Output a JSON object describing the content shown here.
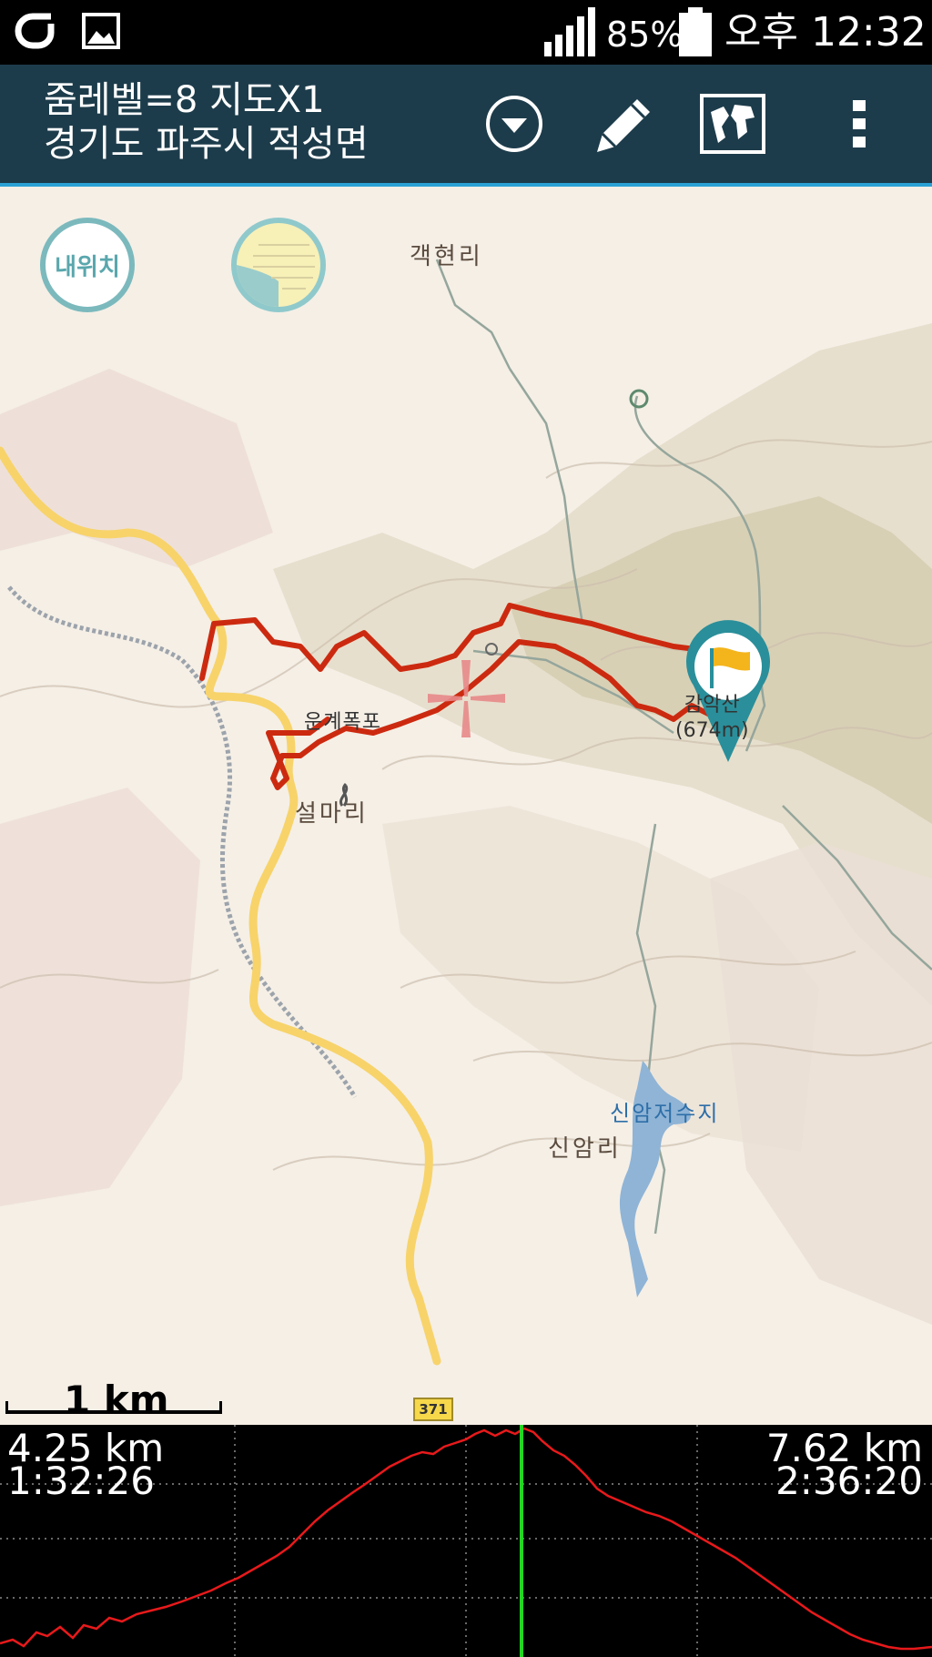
{
  "status_bar": {
    "battery_percent": "85%",
    "time": "오후 12:32",
    "icons": [
      "app-logo-icon",
      "gallery-icon",
      "signal-icon",
      "battery-icon"
    ]
  },
  "app_bar": {
    "zoom_text": "줌레벨=8 지도X1",
    "location_text": "경기도 파주시 적성면",
    "actions": [
      "dropdown-icon",
      "edit-pencil-icon",
      "world-map-icon",
      "overflow-menu-icon"
    ]
  },
  "map": {
    "my_location_label": "내위치",
    "places": {
      "gaekhyeon": "객현리",
      "ungye": "운계폭포",
      "seolma": "설마리",
      "sinam": "신암리",
      "reservoir": "신암저수지"
    },
    "peak_name": "감악산",
    "peak_height": "(674m)",
    "road_badge": "371",
    "scale_label": "1 km",
    "colors": {
      "track": "#cc2a10",
      "road": "#f7d36a",
      "water": "#8fb4d6",
      "marker": "#2a8f9a"
    }
  },
  "profile": {
    "left_distance": "4.25 km",
    "left_time": "1:32:26",
    "right_distance": "7.62 km",
    "right_time": "2:36:20",
    "cursor_fraction": 0.56,
    "colors": {
      "line": "#e8191b",
      "cursor": "#22d622"
    }
  }
}
